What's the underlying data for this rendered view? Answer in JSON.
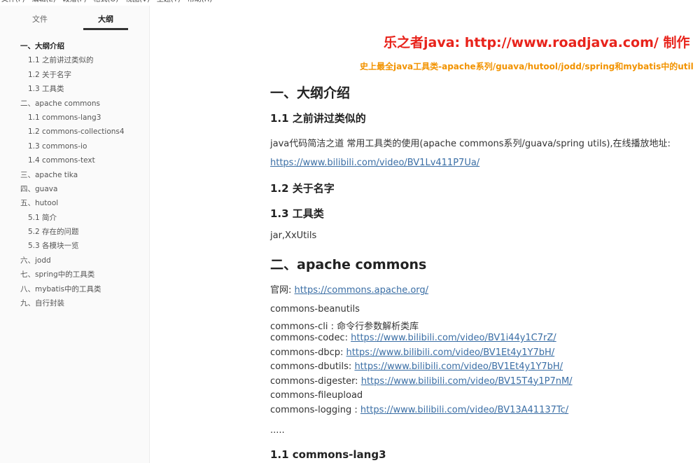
{
  "menu": [
    "文件(F)",
    "编辑(E)",
    "段落(P)",
    "格式(O)",
    "视图(V)",
    "主题(T)",
    "帮助(H)"
  ],
  "sidebar": {
    "tabs": {
      "files": "文件",
      "outline": "大纲"
    },
    "items": [
      {
        "label": "一、大纲介绍",
        "level": 1,
        "active": true
      },
      {
        "label": "1.1 之前讲过类似的",
        "level": 2
      },
      {
        "label": "1.2 关于名字",
        "level": 2
      },
      {
        "label": "1.3 工具类",
        "level": 2
      },
      {
        "label": "二、apache commons",
        "level": 1
      },
      {
        "label": "1.1 commons-lang3",
        "level": 2
      },
      {
        "label": "1.2 commons-collections4",
        "level": 2
      },
      {
        "label": "1.3 commons-io",
        "level": 2
      },
      {
        "label": "1.4 commons-text",
        "level": 2
      },
      {
        "label": "三、apache tika",
        "level": 1
      },
      {
        "label": "四、guava",
        "level": 1
      },
      {
        "label": "五、hutool",
        "level": 1
      },
      {
        "label": "5.1 简介",
        "level": 2
      },
      {
        "label": "5.2 存在的问题",
        "level": 2
      },
      {
        "label": "5.3 各模块一览",
        "level": 2
      },
      {
        "label": "六、jodd",
        "level": 1
      },
      {
        "label": "七、spring中的工具类",
        "level": 1
      },
      {
        "label": "八、mybatis中的工具类",
        "level": 1
      },
      {
        "label": "九、自行封装",
        "level": 1
      }
    ]
  },
  "banner": {
    "line1": "乐之者java: http://www.roadjava.com/ 制作",
    "line2": "史上最全java工具类-apache系列/guava/hutool/jodd/spring和mybatis中的util"
  },
  "doc": {
    "h1_intro": "一、大纲介绍",
    "h2_similar": "1.1 之前讲过类似的",
    "p_similar": "java代码简洁之道 常用工具类的使用(apache commons系列/guava/spring utils),在线播放地址:",
    "link_similar": "https://www.bilibili.com/video/BV1Lv411P7Ua/",
    "h2_name": "1.2 关于名字",
    "h2_tools": "1.3 工具类",
    "p_tools": "jar,XxUtils",
    "h1_apache": "二、apache commons",
    "official_label": "官网: ",
    "official_link": "https://commons.apache.org/",
    "modules": [
      {
        "name": "commons-beanutils",
        "link": ""
      },
      {
        "name": "commons-cli : 命令行参数解析类库",
        "link": ""
      },
      {
        "name": "commons-codec:  ",
        "link": "https://www.bilibili.com/video/BV1i44y1C7rZ/"
      },
      {
        "name": "commons-dbcp: ",
        "link": "https://www.bilibili.com/video/BV1Et4y1Y7bH/"
      },
      {
        "name": "commons-dbutils: ",
        "link": "https://www.bilibili.com/video/BV1Et4y1Y7bH/"
      },
      {
        "name": "commons-digester: ",
        "link": "https://www.bilibili.com/video/BV15T4y1P7nM/"
      },
      {
        "name": "commons-fileupload",
        "link": ""
      },
      {
        "name": "commons-logging : ",
        "link": "https://www.bilibili.com/video/BV13A41137Tc/"
      }
    ],
    "ellipsis": ".....",
    "h2_lang3": "1.1 commons-lang3"
  }
}
